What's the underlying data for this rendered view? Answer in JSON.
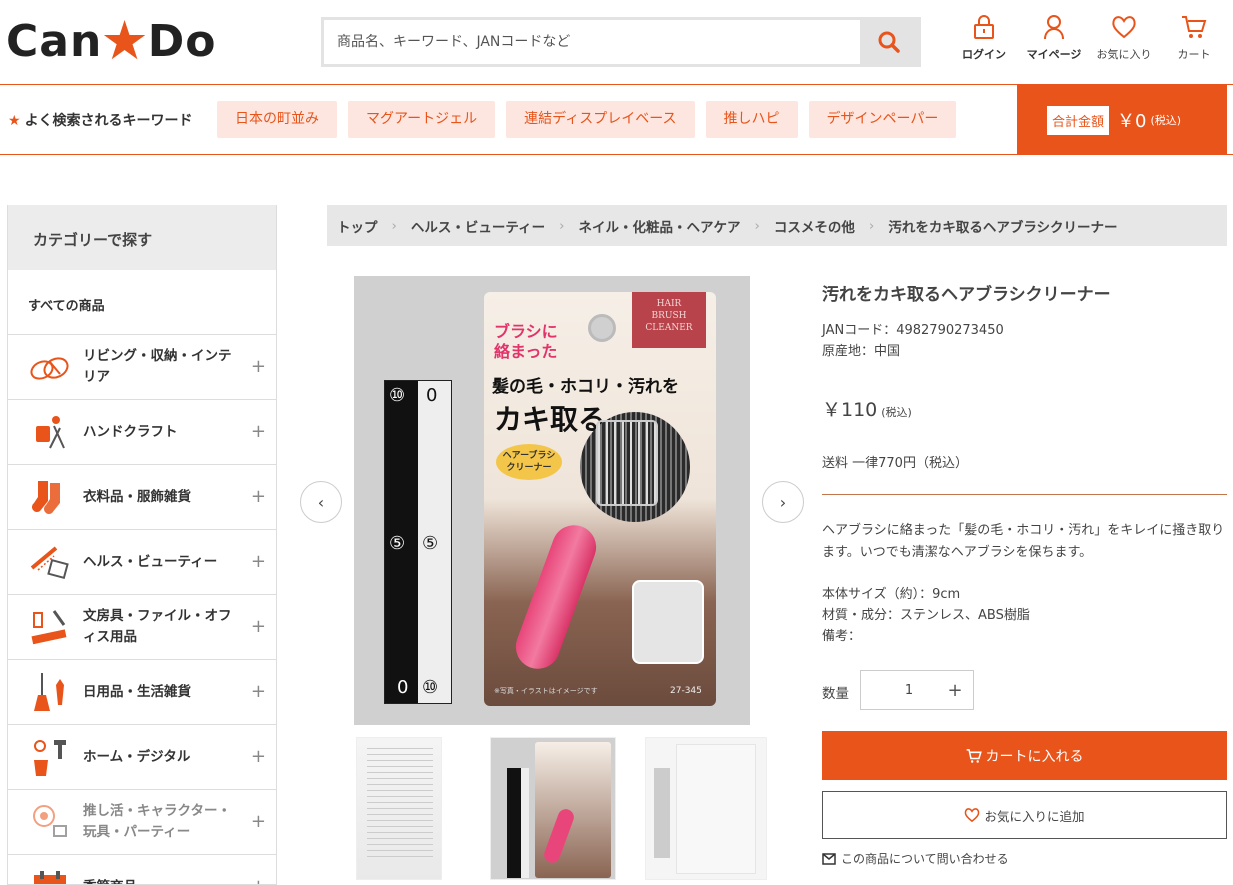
{
  "header": {
    "logo_left": "Can",
    "logo_right": "Do",
    "search_placeholder": "商品名、キーワード、JANコードなど",
    "icons": [
      {
        "label": "ログイン",
        "icon": "lock-icon"
      },
      {
        "label": "マイページ",
        "icon": "user-icon"
      },
      {
        "label": "お気に入り",
        "icon": "heart-icon"
      },
      {
        "label": "カート",
        "icon": "cart-icon"
      }
    ]
  },
  "keywords": {
    "title": "よく検索されるキーワード",
    "items": [
      "日本の町並み",
      "マグアートジェル",
      "連結ディスプレイベース",
      "推しハピ",
      "デザインペーパー"
    ]
  },
  "total": {
    "label": "合計金額",
    "amount": "￥0",
    "tax": "(税込)"
  },
  "sidebar": {
    "title": "カテゴリーで探す",
    "all": "すべての商品",
    "items": [
      {
        "label": "リビング・収納・インテリア",
        "icon": "slippers-icon"
      },
      {
        "label": "ハンドクラフト",
        "icon": "craft-icon"
      },
      {
        "label": "衣料品・服飾雑貨",
        "icon": "socks-icon"
      },
      {
        "label": "ヘルス・ビューティー",
        "icon": "comb-icon"
      },
      {
        "label": "文房具・ファイル・オフィス用品",
        "icon": "stationery-icon"
      },
      {
        "label": "日用品・生活雑貨",
        "icon": "broom-icon"
      },
      {
        "label": "ホーム・デジタル",
        "icon": "tools-icon"
      },
      {
        "label": "推し活・キャラクター・玩具・パーティー",
        "icon": "party-icon"
      },
      {
        "label": "季節商品",
        "icon": "calendar-icon"
      }
    ]
  },
  "breadcrumb": [
    "トップ",
    "ヘルス・ビューティー",
    "ネイル・化粧品・ヘアケア",
    "コスメその他",
    "汚れをカキ取るヘアブラシクリーナー"
  ],
  "product": {
    "title": "汚れをカキ取るヘアブラシクリーナー",
    "jan": "JANコード：4982790273450",
    "origin": "原産地：中国",
    "price": "￥110",
    "price_tax": "(税込)",
    "shipping": "送料 一律770円（税込）",
    "description": "ヘアブラシに絡まった「髪の毛・ホコリ・汚れ」をキレイに掻き取ります。いつでも清潔なヘアブラシを保ちます。",
    "size": "本体サイズ（約）：9cm",
    "material": "材質・成分：ステンレス、ABS樹脂",
    "note": "備考：",
    "package_text1": "ブラシに絡まった",
    "package_text2": "髪の毛・ホコリ・汚れを",
    "package_text3": "カキ取る",
    "package_badge": "ヘアーブラシクリーナー",
    "package_brand": "HAIR BRUSH CLEANER",
    "package_code": "27-345",
    "package_note": "※写真・イラストはイメージです",
    "ruler_top_left": "⑩",
    "ruler_top_right": "0",
    "ruler_mid_left": "⑤",
    "ruler_mid_right": "⑤",
    "ruler_bot_left": "0",
    "ruler_bot_right": "⑩"
  },
  "purchase": {
    "qty_label": "数量",
    "qty_value": "1",
    "plus": "+",
    "cart_button": "カートに入れる",
    "fav_button": "お気に入りに追加",
    "inquiry": "この商品について問い合わせる"
  },
  "colors": {
    "accent": "#e8541a",
    "chip_bg": "#fde6df"
  }
}
